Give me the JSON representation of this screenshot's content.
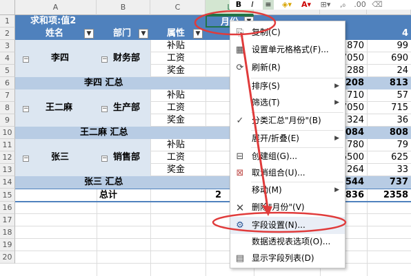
{
  "columns": {
    "a": "A",
    "b": "B",
    "c": "C",
    "d": "L"
  },
  "rows": [
    "1",
    "2",
    "3",
    "4",
    "5",
    "6",
    "7",
    "8",
    "9",
    "10",
    "11",
    "12",
    "13",
    "14",
    "15",
    "16",
    "17",
    "18",
    "19",
    "20"
  ],
  "pivot": {
    "value_label": "求和项:值2",
    "col_field": "月份",
    "header_name": "姓名",
    "header_dept": "部门",
    "header_attr": "属性",
    "col4_header": "4",
    "groups": [
      {
        "name": "李四",
        "dept": "财务部",
        "items": [
          "补贴",
          "工资",
          "奖金"
        ],
        "c3": [
          "870",
          "7050",
          "288"
        ],
        "c4": [
          "99",
          "690",
          "24"
        ],
        "subtotal_label": "李四 汇总",
        "sub3": "208",
        "sub4": "813"
      },
      {
        "name": "王二麻",
        "dept": "生产部",
        "items": [
          "补贴",
          "工资",
          "奖金"
        ],
        "c3": [
          "710",
          "7050",
          "324"
        ],
        "c4": [
          "57",
          "715",
          "36"
        ],
        "subtotal_label": "王二麻 汇总",
        "sub3": "084",
        "sub4": "808"
      },
      {
        "name": "张三",
        "dept": "销售部",
        "items": [
          "补贴",
          "工资",
          "奖金"
        ],
        "c3": [
          "780",
          "5500",
          "264"
        ],
        "c4": [
          "79",
          "625",
          "33"
        ],
        "subtotal_label": "张三 汇总",
        "sub3": "544",
        "sub4": "737"
      }
    ],
    "total_label": "总计",
    "total_c2": "2",
    "total_c3": "836",
    "total_c4": "2358"
  },
  "toolbar": {
    "bold": "B",
    "italic": "I"
  },
  "menu": {
    "copy": "复制(C)",
    "format_cells": "设置单元格格式(F)...",
    "refresh": "刷新(R)",
    "sort": "排序(S)",
    "filter": "筛选(T)",
    "subtotal": "分类汇总\"月份\"(B)",
    "expand": "展开/折叠(E)",
    "group": "创建组(G)...",
    "ungroup": "取消组合(U)...",
    "move": "移动(M)",
    "delete": "删除\"月份\"(V)",
    "field_settings": "字段设置(N)...",
    "pivot_options": "数据透视表选项(O)...",
    "show_field_list": "显示字段列表(D)"
  },
  "accent": {
    "header_blue": "#4f81bd",
    "label_blue": "#dce6f1",
    "subtotal_blue": "#b8cce4",
    "annotation_red": "#e03b3b"
  },
  "icons": [
    "copy-icon",
    "format-cells-icon",
    "refresh-icon",
    "check-icon",
    "group-icon",
    "ungroup-icon",
    "delete-x-icon",
    "field-settings-icon",
    "field-list-icon"
  ]
}
